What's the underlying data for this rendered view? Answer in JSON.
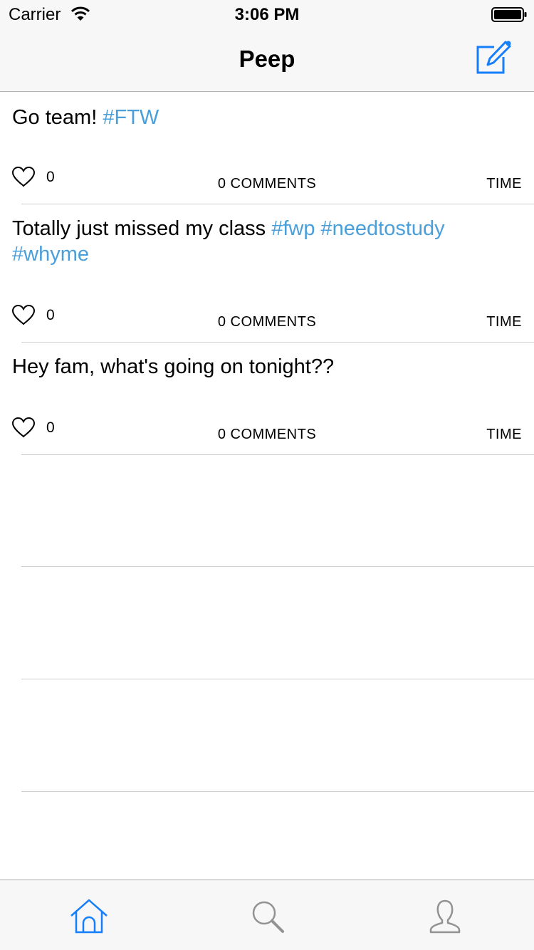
{
  "status_bar": {
    "carrier": "Carrier",
    "time": "3:06 PM"
  },
  "nav": {
    "title": "Peep",
    "compose_icon": "compose-icon"
  },
  "posts": [
    {
      "text_segments": [
        {
          "text": "Go team! ",
          "hashtag": false
        },
        {
          "text": "#FTW",
          "hashtag": true
        }
      ],
      "likes": "0",
      "comments_label": "0 COMMENTS",
      "time_label": "TIME"
    },
    {
      "text_segments": [
        {
          "text": "Totally just missed my class ",
          "hashtag": false
        },
        {
          "text": "#fwp",
          "hashtag": true
        },
        {
          "text": " ",
          "hashtag": false
        },
        {
          "text": "#needtostudy",
          "hashtag": true
        },
        {
          "text": " ",
          "hashtag": false
        },
        {
          "text": "#whyme",
          "hashtag": true
        }
      ],
      "likes": "0",
      "comments_label": "0 COMMENTS",
      "time_label": "TIME"
    },
    {
      "text_segments": [
        {
          "text": "Hey fam, what's going on tonight??",
          "hashtag": false
        }
      ],
      "likes": "0",
      "comments_label": "0 COMMENTS",
      "time_label": "TIME"
    }
  ],
  "tabs": [
    {
      "name": "home",
      "icon": "home-icon",
      "active": true
    },
    {
      "name": "search",
      "icon": "search-icon",
      "active": false
    },
    {
      "name": "profile",
      "icon": "profile-icon",
      "active": false
    }
  ],
  "colors": {
    "accent": "#157efb",
    "hashtag": "#4a9fda",
    "inactive_icon": "#929292",
    "bar_background": "#f7f7f7"
  }
}
